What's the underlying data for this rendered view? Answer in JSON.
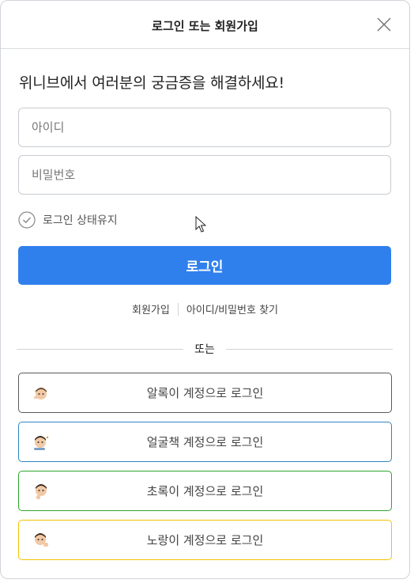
{
  "header": {
    "title": "로그인 또는 회원가입"
  },
  "headline": "위니브에서 여러분의 궁금증을 해결하세요!",
  "form": {
    "id_placeholder": "아이디",
    "password_placeholder": "비밀번호",
    "keep_login_label": "로그인 상태유지",
    "login_button": "로그인"
  },
  "links": {
    "signup": "회원가입",
    "find": "아이디/비밀번호 찾기"
  },
  "divider_text": "또는",
  "social": [
    {
      "label": "알록이 계정으로 로그인",
      "color": "#5a5a5a"
    },
    {
      "label": "얼굴책 계정으로 로그인",
      "color": "#2e86c1"
    },
    {
      "label": "초록이 계정으로 로그인",
      "color": "#2ea52e"
    },
    {
      "label": "노랑이 계정으로 로그인",
      "color": "#f2c200"
    }
  ],
  "colors": {
    "primary": "#2f80ed"
  }
}
